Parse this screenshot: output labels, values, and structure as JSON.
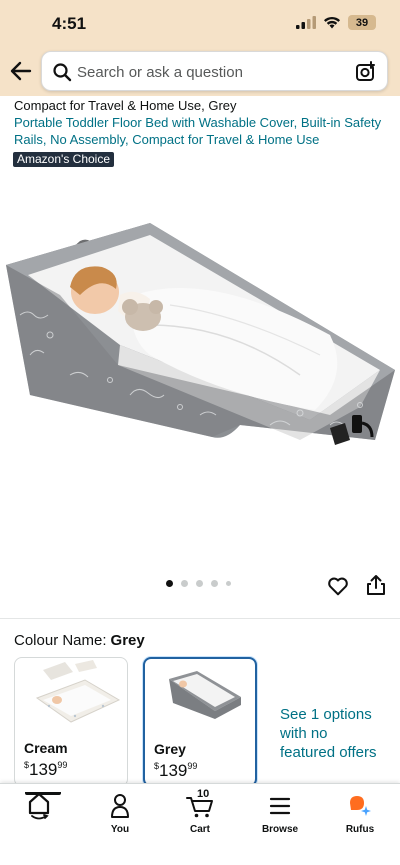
{
  "status_bar": {
    "time": "4:51",
    "battery": "39"
  },
  "search": {
    "placeholder": "Search or ask a question"
  },
  "product": {
    "title_fragment": "Compact for Travel & Home Use, Grey",
    "subtitle": "Portable Toddler Floor Bed with Washable Cover, Built-in Safety Rails, No Assembly, Compact for Travel & Home Use",
    "badge": "Amazon's Choice",
    "image_dots": {
      "count": 5,
      "active_index": 0
    }
  },
  "colour": {
    "label": "Colour Name:",
    "selected": "Grey",
    "options": [
      {
        "name": "Cream",
        "currency": "$",
        "price_whole": "139",
        "price_fraction": "99",
        "selected": false
      },
      {
        "name": "Grey",
        "currency": "$",
        "price_whole": "139",
        "price_fraction": "99",
        "selected": true
      }
    ],
    "see_options": "See 1 options with no featured offers"
  },
  "nav": {
    "items": [
      {
        "label": "",
        "icon": "home-icon",
        "active": true
      },
      {
        "label": "You",
        "icon": "person-icon"
      },
      {
        "label": "Cart",
        "icon": "cart-icon",
        "count": "10"
      },
      {
        "label": "Browse",
        "icon": "menu-icon"
      },
      {
        "label": "Rufus",
        "icon": "rufus-icon"
      }
    ]
  },
  "colors": {
    "header_bg": "#f5e2c8",
    "link": "#007185",
    "badge_bg": "#232f3e",
    "selected_border": "#2162a1",
    "rufus_orange": "#ff6d1f",
    "rufus_blue": "#4aa3ff"
  }
}
